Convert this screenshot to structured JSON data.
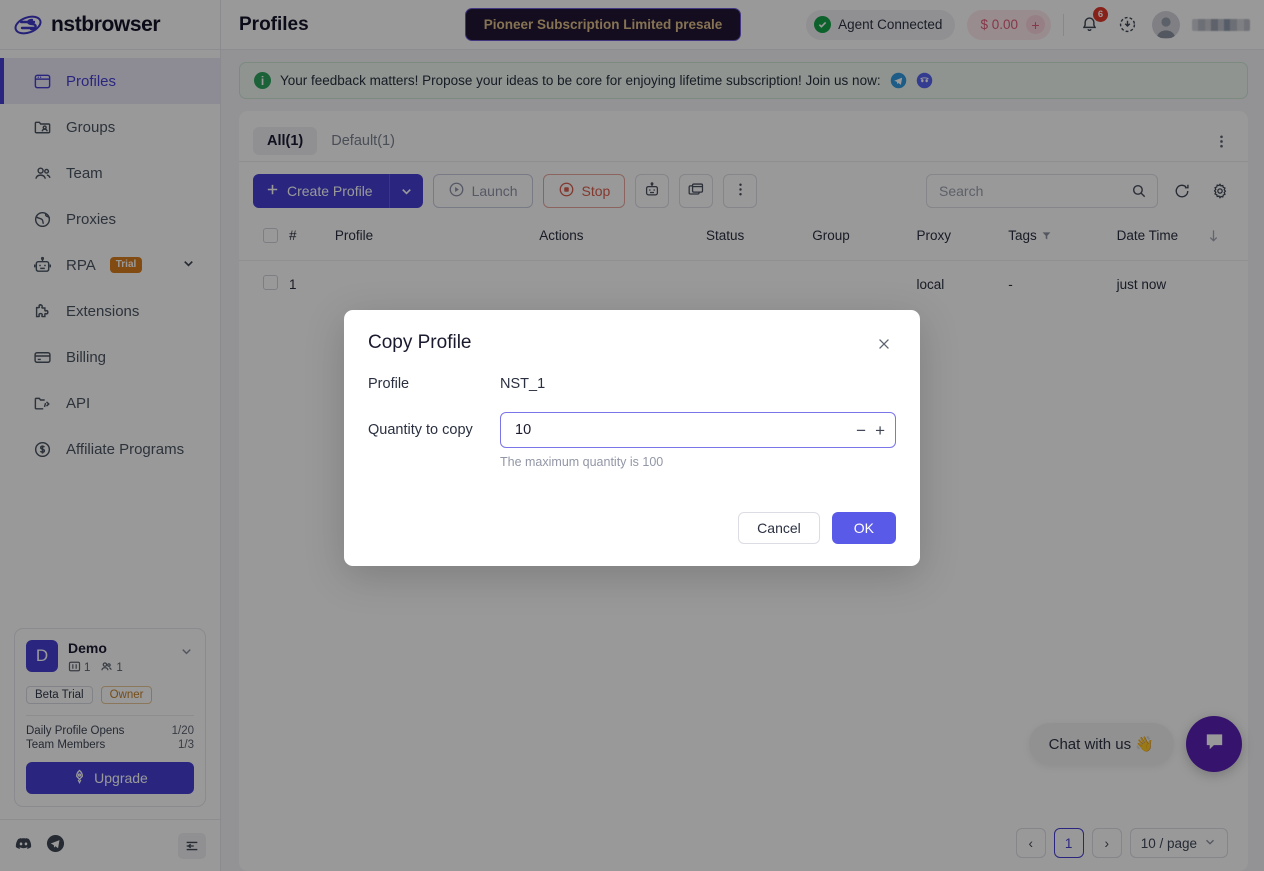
{
  "brand": {
    "name": "nstbrowser",
    "logo_icon": "nstbrowser-logo-icon",
    "accent": "#4640d4"
  },
  "sidebar": {
    "items": [
      {
        "label": "Profiles",
        "icon": "browser-window-icon",
        "active": true
      },
      {
        "label": "Groups",
        "icon": "folder-user-icon",
        "active": false
      },
      {
        "label": "Team",
        "icon": "people-icon",
        "active": false
      },
      {
        "label": "Proxies",
        "icon": "globe-icon",
        "active": false
      },
      {
        "label": "RPA",
        "icon": "robot-icon",
        "active": false,
        "badge": "Trial",
        "expandable": true
      },
      {
        "label": "Extensions",
        "icon": "puzzle-icon",
        "active": false
      },
      {
        "label": "Billing",
        "icon": "credit-card-icon",
        "active": false
      },
      {
        "label": "API",
        "icon": "folder-code-icon",
        "active": false
      },
      {
        "label": "Affiliate Programs",
        "icon": "dollar-circle-icon",
        "active": false
      }
    ],
    "account": {
      "avatar_letter": "D",
      "name": "Demo",
      "profiles_count": "1",
      "members_count": "1",
      "plan_badge": "Beta Trial",
      "role_badge": "Owner",
      "quota": [
        {
          "label": "Daily Profile Opens",
          "value": "1/20"
        },
        {
          "label": "Team Members",
          "value": "1/3"
        }
      ],
      "upgrade_label": "Upgrade"
    },
    "footer_icons": [
      "discord-icon",
      "telegram-icon",
      "collapse-sidebar-icon"
    ]
  },
  "topbar": {
    "title": "Profiles",
    "promo_label": "Pioneer Subscription Limited presale",
    "agent_status": "Agent Connected",
    "balance": "$ 0.00",
    "balance_add": "+",
    "notification_count": "6",
    "icons": [
      "bell-icon",
      "download-icon",
      "avatar-icon"
    ]
  },
  "feedback": {
    "text": "Your feedback matters! Propose your ideas to be core for enjoying lifetime subscription! Join us now:",
    "info_glyph": "i",
    "links": [
      "telegram-icon",
      "discord-icon"
    ]
  },
  "tabs": [
    {
      "label": "All(1)",
      "active": true
    },
    {
      "label": "Default(1)",
      "active": false
    }
  ],
  "toolbar": {
    "create_label": "Create Profile",
    "launch_label": "Launch",
    "stop_label": "Stop",
    "icon_buttons": [
      "robot-icon",
      "windows-stack-icon",
      "more-vertical-icon"
    ],
    "search_placeholder": "Search",
    "search_value": "",
    "refresh_icon": "refresh-icon",
    "settings_icon": "gear-icon"
  },
  "table": {
    "columns": [
      "#",
      "Profile",
      "Actions",
      "Status",
      "Group",
      "Proxy",
      "Tags",
      "Date Time"
    ],
    "rows": [
      {
        "num": "1",
        "profile": "",
        "actions": "",
        "status": "",
        "group": "",
        "proxy": "local",
        "tags": "-",
        "datetime": "just now"
      }
    ]
  },
  "pager": {
    "prev": "‹",
    "next": "›",
    "current_page": "1",
    "page_size": "10 / page"
  },
  "chat": {
    "label": "Chat with us 👋",
    "fab_icon": "chat-bubble-icon"
  },
  "modal": {
    "title": "Copy Profile",
    "close_icon": "close-icon",
    "profile_label": "Profile",
    "profile_value": "NST_1",
    "quantity_label": "Quantity to copy",
    "quantity_value": "10",
    "hint": "The maximum quantity is 100",
    "minus": "−",
    "plus": "+",
    "cancel_label": "Cancel",
    "ok_label": "OK"
  }
}
